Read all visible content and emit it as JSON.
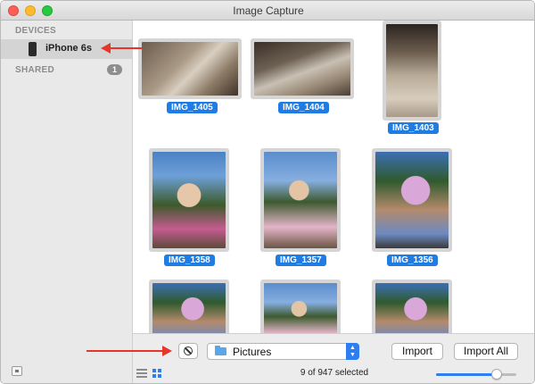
{
  "window": {
    "title": "Image Capture"
  },
  "sidebar": {
    "devices_header": "DEVICES",
    "device": {
      "label": "iPhone 6s",
      "icon": "iphone-icon"
    },
    "shared_header": "SHARED",
    "shared_count": "1"
  },
  "photos": [
    {
      "name": "IMG_1405"
    },
    {
      "name": "IMG_1404"
    },
    {
      "name": "IMG_1403"
    },
    {
      "name": "IMG_1358"
    },
    {
      "name": "IMG_1357"
    },
    {
      "name": "IMG_1356"
    }
  ],
  "toolbar": {
    "destination": "Pictures",
    "import_label": "Import",
    "import_all_label": "Import All",
    "selection_status": "9 of 947 selected",
    "thumbnail_size_fraction": 0.75
  },
  "colors": {
    "selection_label": "#1f7ce3",
    "accent": "#2f7ef0",
    "annotation_arrow": "#e8352a"
  }
}
